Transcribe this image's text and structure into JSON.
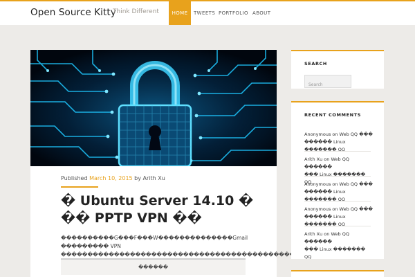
{
  "site": {
    "title": "Open Source Kitty",
    "tagline": "Think Different"
  },
  "nav": {
    "items": [
      {
        "label": "HOME",
        "active": true
      },
      {
        "label": "TWEETS",
        "active": false
      },
      {
        "label": "PORTFOLIO",
        "active": false
      },
      {
        "label": "ABOUT",
        "active": false
      }
    ]
  },
  "post": {
    "published_prefix": "Published",
    "date": "March 10, 2015",
    "by_prefix": "by",
    "author": "Arith Xu",
    "title": "� Ubuntu Server 14.10 � �� PPTP VPN ��",
    "excerpt": "����������G���F���W��������������Gmail ��������� VPN ����������������������������������������������������� PPTP VPN �����",
    "read_more": "������"
  },
  "sidebar": {
    "search": {
      "title": "SEARCH",
      "placeholder": "Search"
    },
    "recent_comments": {
      "title": "RECENT COMMENTS",
      "items": [
        {
          "line1": "Anonymous on Web QQ ���",
          "line2": "������ Linux ������� QQ"
        },
        {
          "line1": "Arith Xu on Web QQ ������",
          "line2": "��� Linux ������� QQ"
        },
        {
          "line1": "Anonymous on Web QQ ���",
          "line2": "������ Linux ������� QQ"
        },
        {
          "line1": "Anonymous on Web QQ ���",
          "line2": "������ Linux ������� QQ"
        },
        {
          "line1": "Arith Xu on Web QQ ������",
          "line2": "��� Linux ������� QQ"
        }
      ]
    }
  },
  "colors": {
    "accent": "#e8a21c",
    "background": "#edebe8",
    "card": "#ffffff",
    "hero_glow": "#1fc8ff"
  },
  "icons": {
    "hero": "padlock-circuit-image"
  }
}
